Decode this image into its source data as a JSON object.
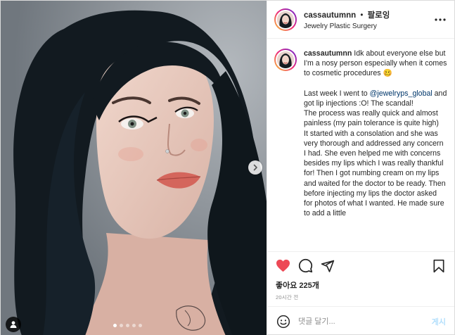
{
  "header": {
    "username": "cassautumnn",
    "separator": "•",
    "follow_label": "팔로잉",
    "location": "Jewelry Plastic Surgery",
    "more_icon": "more-horizontal-icon"
  },
  "caption": {
    "username": "cassautumnn",
    "intro": "Idk about everyone else but I'm a nosy person especially when it comes to cosmetic procedures 🥴",
    "para1_prefix": "Last week I went to ",
    "mention": "@jewelryps_global",
    "para1_suffix": " and got lip injections :O! The scandal!",
    "para2": "The process was really quick and almost painless (my pain tolerance is quite high)",
    "para3": "It started with a consolation and she was very thorough and addressed any concern I had. She even helped me with concerns besides my lips which I was really thankful for! Then I got numbing cream on my lips and waited for the doctor to be ready. Then before injecting my lips the doctor asked for photos of what I wanted. He made sure to add a little"
  },
  "actions": {
    "like_icon": "heart-filled-icon",
    "comment_icon": "comment-icon",
    "share_icon": "share-icon",
    "save_icon": "bookmark-icon",
    "like_color": "#ed4956"
  },
  "likes": {
    "text": "좋아요 225개"
  },
  "timestamp": {
    "text": "20시간 전"
  },
  "comment": {
    "placeholder": "댓글 달기...",
    "value": "",
    "post_label": "게시",
    "emoji_icon": "emoji-icon"
  },
  "carousel": {
    "slide_count": 5,
    "active_index": 0,
    "next_icon": "chevron-right-icon",
    "user_tag_icon": "user-tag-icon"
  }
}
